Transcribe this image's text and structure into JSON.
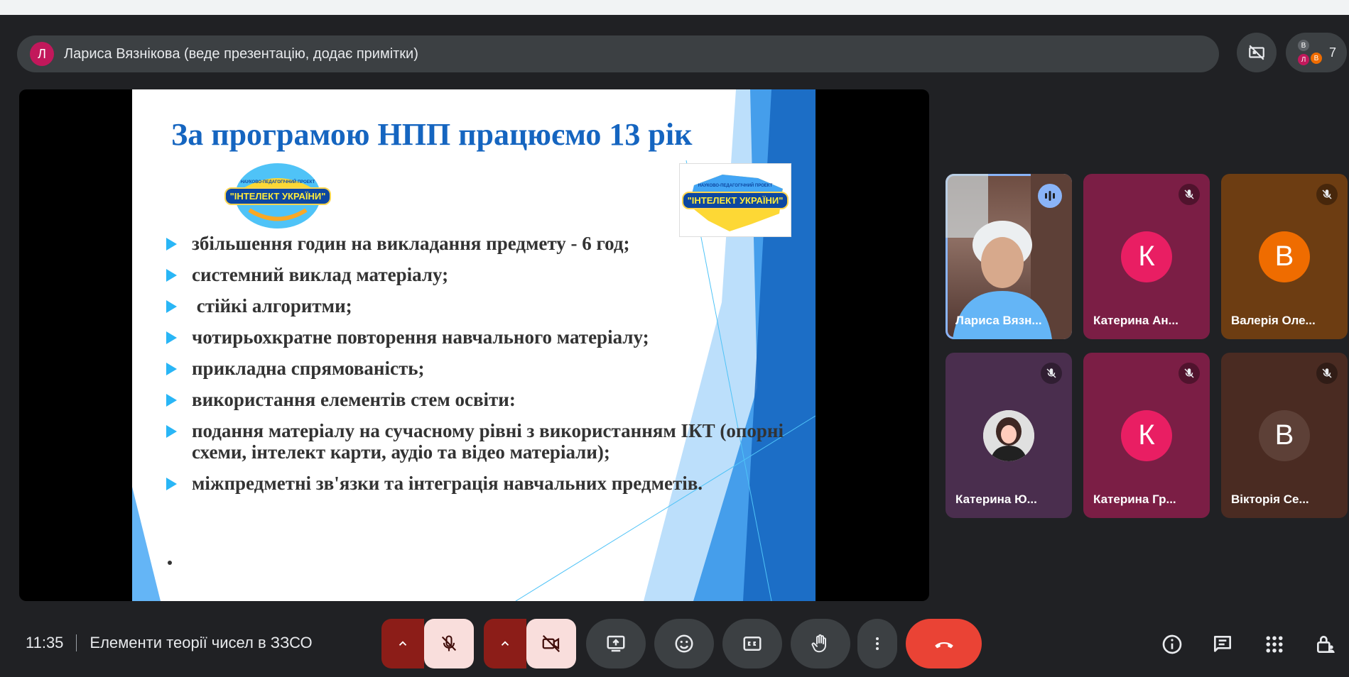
{
  "presenter": {
    "avatar_letter": "Л",
    "text": "Лариса Вязнікова (веде презентацію, додає примітки)"
  },
  "people": {
    "count": "7",
    "mini_avatars": [
      "В",
      "Л",
      "В"
    ]
  },
  "slide": {
    "title": "За програмою НПП працюємо 13 рік",
    "logo_text": "\"ІНТЕЛЕКТ УКРАЇНИ\"",
    "logo_subtext": "НАУКОВО-ПЕДАГОГІЧНИЙ ПРОЕКТ",
    "bullets": [
      "збільшення годин на викладання предмету - 6 год;",
      "системний виклад матеріалу;",
      " стійкі алгоритми;",
      "чотирьохкратне повторення навчального матеріалу;",
      "прикладна спрямованість;",
      "використання елементів стем освіти:",
      "подання матеріалу на сучасному рівні з використанням ІКТ (опорні схеми, інтелект карти, аудіо та відео матеріали);",
      "міжпредметні зв'язки та інтеграція навчальних предметів."
    ]
  },
  "participants": [
    {
      "name": "Лариса Вязн...",
      "type": "video",
      "speaking": true
    },
    {
      "name": "Катерина Ан...",
      "letter": "К",
      "bg": "#7b1e45",
      "avatar_bg": "#e91e63",
      "muted": true
    },
    {
      "name": "Валерія Оле...",
      "letter": "В",
      "bg": "#6d3d12",
      "avatar_bg": "#ef6c00",
      "muted": true
    },
    {
      "name": "Катерина Ю...",
      "type": "photo",
      "bg": "#4a2e4e",
      "muted": true
    },
    {
      "name": "Катерина Гр...",
      "letter": "К",
      "bg": "#7b1e45",
      "avatar_bg": "#e91e63",
      "muted": true
    },
    {
      "name": "Вікторія Се...",
      "letter": "В",
      "bg": "#4a2b22",
      "avatar_bg": "#5d4037",
      "muted": true
    }
  ],
  "meeting": {
    "time": "11:35",
    "title": "Елементи теорії чисел в ЗЗСО"
  },
  "colors": {
    "end_call": "#ea4335",
    "mic_off_bg": "#f9dedc",
    "mic_off_group": "#8c1d18",
    "active_speaker": "#8ab4f8"
  }
}
